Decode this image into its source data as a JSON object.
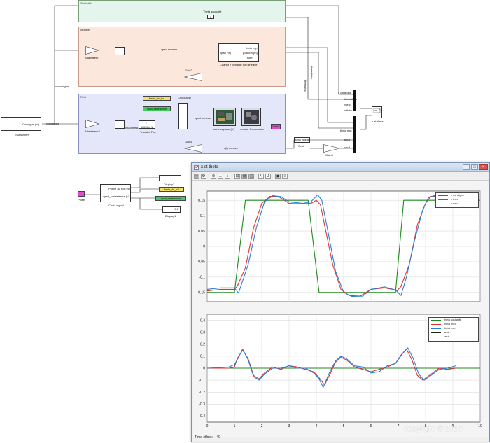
{
  "model": {
    "subsystems": {
      "souhaite": {
        "title": "Souhaité",
        "color": "#e3f5ec"
      },
      "modele": {
        "title": "Modèle",
        "color": "#fbe7dc"
      },
      "reel": {
        "title": "Réel",
        "color": "#e4e7fa"
      }
    },
    "labels": {
      "theta_souhaite": "Theta souhaité",
      "consigne_line": "x consigne",
      "x_consigne_sub": "x consigne",
      "consigne_out": "Consigne (m)",
      "subsystem": "Subsystem",
      "adaptateur": "Adaptateur",
      "adaptateur2": "Adaptateur2",
      "xpad_mesure": "xpad mesure",
      "xpad_mesure2": "xpad mesure",
      "xpad_mesure3": "xpad mesure",
      "mode_in": "xpad (%)",
      "theta_exp": "theta exp",
      "position_m": "position (m)",
      "fuite": "fuite",
      "chariot_pendule": "Chariot + pendule non linéaire",
      "gain2": "Gain2",
      "gain1": "Gain1",
      "gain3": "Gain3",
      "theta_theo_v": "theta théo",
      "theta_exp_v": "theta exp",
      "transfer_fcn": "Transfer Fcn",
      "tf_text": "1 / 0.035s+1",
      "choix_algo": "Choix algo",
      "x_mesure": "x(t) mesure",
      "x_exp": "x exp",
      "x_theo": "x théo",
      "x_exp2": "x exp",
      "theta_exp2": "theta exp",
      "seuil_plus": "seuil+",
      "seuil_moins": "seuil-",
      "seuil_theta": "seuil_theta",
      "seuil_label": "Seuil",
      "carte_capteur": "carte capteur (V)",
      "moteur_commande": "moteur Commande",
      "gain_3": "Gain3",
      "x_et_theta_scope": "x et theta",
      "pente_vert": "Pente_du_bol",
      "goto_tag": "xpad_cartesienne",
      "profile_block": "Profile au bol (%)",
      "xpad_cart_out": "xpad_cartesienne (V)",
      "choix_signal": "Choix signal",
      "display3": "Display3",
      "display1": "Display1",
      "pulse": "Pulse",
      "disp1_val": "",
      "disp3_val": "0.5"
    }
  },
  "window": {
    "title": "x et theta",
    "time_offset_label": "Time offset:",
    "time_offset_value": "40",
    "toolbar_icons": [
      "print-icon",
      "settings-icon",
      "zoom-in-icon",
      "zoom-x-icon",
      "zoom-y-icon",
      "autoscale-icon",
      "save-axes-icon",
      "restore-axes-icon",
      "pointer-icon",
      "restore-icon",
      "lock-icon",
      "legend-icon"
    ]
  },
  "watermark": "copyright © 2010",
  "chart_data": [
    {
      "type": "line",
      "title": "",
      "xlabel": "",
      "ylabel": "",
      "xlim": [
        0,
        10
      ],
      "ylim": [
        -0.18,
        0.18
      ],
      "yticks": [
        -0.15,
        -0.1,
        -0.05,
        0,
        0.05,
        0.1,
        0.15
      ],
      "grid": true,
      "legend_position": "top-right",
      "series": [
        {
          "name": "x consigne",
          "color": "#1e8a1e",
          "x": [
            0,
            1.0,
            1.4,
            3.7,
            4.1,
            6.9,
            7.2,
            8.0,
            10
          ],
          "y": [
            -0.15,
            -0.15,
            0.15,
            0.15,
            -0.15,
            -0.15,
            0.15,
            0.15,
            0.15
          ]
        },
        {
          "name": "x théo",
          "color": "#e03030",
          "x": [
            0,
            0.5,
            1.0,
            1.1,
            1.4,
            1.7,
            2.0,
            2.3,
            2.6,
            3.0,
            3.5,
            3.8,
            4.0,
            4.15,
            4.3,
            4.6,
            4.9,
            5.2,
            5.6,
            6.0,
            6.5,
            6.8,
            6.95,
            7.1,
            7.4,
            7.7,
            8.0,
            8.2,
            8.5
          ],
          "y": [
            -0.145,
            -0.14,
            -0.14,
            -0.13,
            -0.07,
            0.06,
            0.14,
            0.163,
            0.163,
            0.14,
            0.138,
            0.14,
            0.15,
            0.135,
            0.07,
            -0.06,
            -0.14,
            -0.16,
            -0.162,
            -0.14,
            -0.135,
            -0.14,
            -0.145,
            -0.13,
            -0.06,
            0.07,
            0.14,
            0.163,
            0.163
          ]
        },
        {
          "name": "x exp",
          "color": "#2a7fd4",
          "x": [
            0,
            0.5,
            1.0,
            1.15,
            1.5,
            1.8,
            2.1,
            2.4,
            2.7,
            3.0,
            3.5,
            3.8,
            4.05,
            4.2,
            4.4,
            4.7,
            5.0,
            5.3,
            5.7,
            6.0,
            6.5,
            6.9,
            7.1,
            7.3,
            7.6,
            7.9,
            8.1,
            8.3,
            8.5
          ],
          "y": [
            -0.14,
            -0.135,
            -0.135,
            -0.152,
            -0.06,
            0.06,
            0.145,
            0.165,
            0.162,
            0.145,
            0.14,
            0.145,
            0.168,
            0.15,
            0.06,
            -0.08,
            -0.15,
            -0.163,
            -0.162,
            -0.14,
            -0.132,
            -0.142,
            -0.16,
            -0.1,
            0.02,
            0.12,
            0.158,
            0.165,
            0.165
          ]
        }
      ]
    },
    {
      "type": "line",
      "title": "",
      "xlabel": "",
      "ylabel": "",
      "xlim": [
        0,
        10
      ],
      "ylim": [
        -0.45,
        0.45
      ],
      "yticks": [
        -0.4,
        -0.3,
        -0.2,
        -0.1,
        0,
        0.1,
        0.2,
        0.3,
        0.4
      ],
      "xticks": [
        0,
        1,
        2,
        3,
        4,
        5,
        6,
        7,
        8,
        9,
        10
      ],
      "grid": true,
      "legend_position": "top-right",
      "series": [
        {
          "name": "theta souhaité",
          "color": "#1e8a1e",
          "x": [
            0,
            10
          ],
          "y": [
            0,
            0
          ]
        },
        {
          "name": "theta théo",
          "color": "#e03030",
          "x": [
            0,
            0.8,
            1.0,
            1.1,
            1.3,
            1.5,
            1.7,
            1.9,
            2.1,
            2.4,
            2.7,
            3.0,
            3.3,
            3.6,
            3.9,
            4.1,
            4.3,
            4.5,
            4.7,
            4.9,
            5.1,
            5.4,
            5.7,
            6.0,
            6.3,
            6.6,
            6.9,
            7.1,
            7.3,
            7.5,
            7.7,
            7.9,
            8.2,
            8.5,
            8.8,
            9.1
          ],
          "y": [
            0.0,
            0.0,
            0.01,
            0.08,
            0.15,
            0.08,
            -0.06,
            -0.09,
            -0.04,
            0.01,
            -0.01,
            0.02,
            0.01,
            -0.01,
            -0.03,
            -0.08,
            -0.14,
            -0.05,
            0.05,
            0.09,
            0.07,
            0.01,
            -0.01,
            -0.03,
            -0.01,
            0.01,
            0.04,
            0.11,
            0.16,
            0.07,
            -0.06,
            -0.1,
            -0.05,
            0.0,
            -0.01,
            0.0
          ]
        },
        {
          "name": "theta exp",
          "color": "#2a7fd4",
          "x": [
            0,
            0.8,
            1.0,
            1.15,
            1.3,
            1.5,
            1.7,
            1.9,
            2.1,
            2.4,
            2.7,
            3.0,
            3.3,
            3.6,
            3.9,
            4.1,
            4.25,
            4.45,
            4.7,
            4.9,
            5.1,
            5.4,
            5.7,
            6.0,
            6.3,
            6.6,
            6.9,
            7.15,
            7.35,
            7.55,
            7.75,
            7.95,
            8.2,
            8.5,
            8.8,
            9.1
          ],
          "y": [
            0.0,
            0.01,
            0.03,
            0.09,
            0.16,
            0.07,
            -0.07,
            -0.1,
            -0.05,
            0.0,
            0.0,
            0.02,
            0.0,
            0.0,
            -0.04,
            -0.09,
            -0.16,
            -0.05,
            0.06,
            0.1,
            0.08,
            0.02,
            0.01,
            -0.04,
            -0.03,
            0.02,
            0.04,
            0.12,
            0.17,
            0.08,
            -0.05,
            -0.1,
            -0.06,
            -0.01,
            0.0,
            0.02
          ]
        },
        {
          "name": "seuil+",
          "color": "#222222",
          "x": [],
          "y": []
        },
        {
          "name": "seuil-",
          "color": "#222222",
          "x": [],
          "y": []
        }
      ]
    }
  ]
}
